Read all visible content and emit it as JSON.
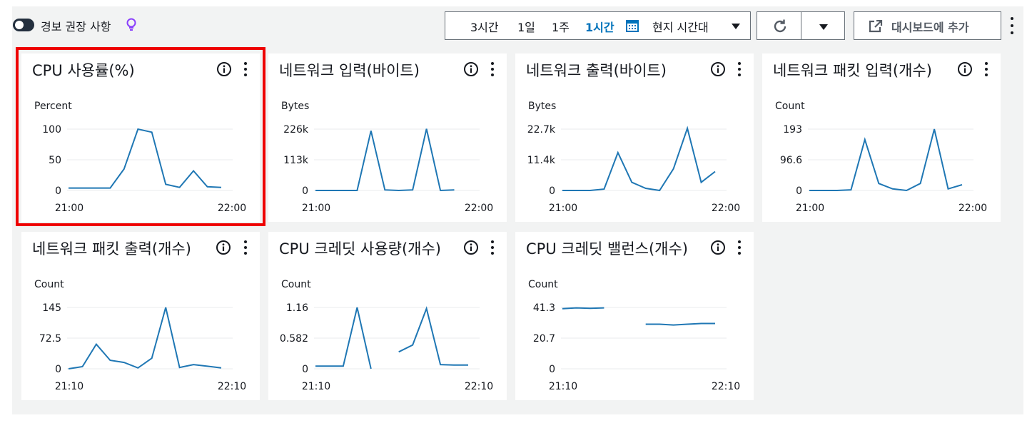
{
  "toolbar": {
    "alarm_label": "경보 권장 사항",
    "alarm_enabled": false,
    "time_options": [
      {
        "label": "3시간",
        "active": false
      },
      {
        "label": "1일",
        "active": false
      },
      {
        "label": "1주",
        "active": false
      },
      {
        "label": "1시간",
        "active": true
      }
    ],
    "timezone": "현지 시간대",
    "add_to_dashboard": "대시보드에 추가",
    "icons": {
      "bulb": "lightbulb-icon",
      "calendar": "calendar-icon",
      "refresh": "refresh-icon",
      "external": "external-link-icon"
    }
  },
  "colors": {
    "line": "#1f77b4",
    "accent": "#0073bb",
    "highlight": "#ee0000",
    "grid": "#e9ebed"
  },
  "widgets": [
    {
      "title": "CPU 사용률(%)",
      "unit": "Percent",
      "yticks": [
        "100",
        "50",
        "0"
      ],
      "ymax": 100,
      "xticks": [
        "21:00",
        "22:00"
      ],
      "selected": true
    },
    {
      "title": "네트워크 입력(바이트)",
      "unit": "Bytes",
      "yticks": [
        "226k",
        "113k",
        "0"
      ],
      "ymax": 226000,
      "xticks": [
        "21:00",
        "22:00"
      ]
    },
    {
      "title": "네트워크 출력(바이트)",
      "unit": "Bytes",
      "yticks": [
        "22.7k",
        "11.4k",
        "0"
      ],
      "ymax": 22700,
      "xticks": [
        "21:00",
        "22:00"
      ]
    },
    {
      "title": "네트워크 패킷 입력(개수)",
      "unit": "Count",
      "yticks": [
        "193",
        "96.6",
        "0"
      ],
      "ymax": 193,
      "xticks": [
        "21:00",
        "22:00"
      ]
    },
    {
      "title": "네트워크 패킷 출력(개수)",
      "unit": "Count",
      "yticks": [
        "145",
        "72.5",
        "0"
      ],
      "ymax": 145,
      "xticks": [
        "21:10",
        "22:10"
      ]
    },
    {
      "title": "CPU 크레딧 사용량(개수)",
      "unit": "Count",
      "yticks": [
        "1.16",
        "0.582",
        "0"
      ],
      "ymax": 1.16,
      "xticks": [
        "21:10",
        "22:10"
      ]
    },
    {
      "title": "CPU 크레딧 밸런스(개수)",
      "unit": "Count",
      "yticks": [
        "41.3",
        "20.7",
        "0"
      ],
      "ymax": 41.3,
      "xticks": [
        "21:10",
        "22:10"
      ]
    }
  ],
  "chart_data": [
    {
      "type": "line",
      "title": "CPU 사용률(%)",
      "ylabel": "Percent",
      "xrange": [
        "21:00",
        "22:00"
      ],
      "ylim": [
        0,
        100
      ],
      "x_minutes": [
        0,
        5,
        10,
        15,
        20,
        25,
        30,
        35,
        40,
        45,
        50,
        55,
        60
      ],
      "series": [
        {
          "values": [
            4,
            4,
            4,
            4,
            35,
            100,
            95,
            10,
            5,
            32,
            6,
            5,
            null
          ]
        }
      ]
    },
    {
      "type": "line",
      "title": "네트워크 입력(바이트)",
      "ylabel": "Bytes",
      "xrange": [
        "21:00",
        "22:00"
      ],
      "ylim": [
        0,
        226000
      ],
      "x_minutes": [
        0,
        5,
        10,
        15,
        20,
        25,
        30,
        35,
        40,
        45,
        50,
        55,
        60
      ],
      "series": [
        {
          "values": [
            0,
            0,
            0,
            0,
            220000,
            2000,
            0,
            2000,
            227000,
            0,
            2000,
            null,
            null
          ]
        }
      ]
    },
    {
      "type": "line",
      "title": "네트워크 출력(바이트)",
      "ylabel": "Bytes",
      "xrange": [
        "21:00",
        "22:00"
      ],
      "ylim": [
        0,
        22700
      ],
      "x_minutes": [
        0,
        5,
        10,
        15,
        20,
        25,
        30,
        35,
        40,
        45,
        50,
        55,
        60
      ],
      "series": [
        {
          "values": [
            0,
            0,
            0,
            500,
            14000,
            3000,
            800,
            0,
            8000,
            23000,
            3000,
            7000,
            null
          ]
        }
      ]
    },
    {
      "type": "line",
      "title": "네트워크 패킷 입력(개수)",
      "ylabel": "Count",
      "xrange": [
        "21:00",
        "22:00"
      ],
      "ylim": [
        0,
        193
      ],
      "x_minutes": [
        0,
        5,
        10,
        15,
        20,
        25,
        30,
        35,
        40,
        45,
        50,
        55,
        60
      ],
      "series": [
        {
          "values": [
            0,
            0,
            0,
            2,
            160,
            22,
            5,
            0,
            22,
            193,
            5,
            18,
            null
          ]
        }
      ]
    },
    {
      "type": "line",
      "title": "네트워크 패킷 출력(개수)",
      "ylabel": "Count",
      "xrange": [
        "21:10",
        "22:10"
      ],
      "ylim": [
        0,
        145
      ],
      "x_minutes": [
        0,
        5,
        10,
        15,
        20,
        25,
        30,
        35,
        40,
        45,
        50,
        55,
        60
      ],
      "series": [
        {
          "values": [
            0,
            5,
            58,
            20,
            15,
            2,
            25,
            145,
            3,
            10,
            6,
            2,
            null
          ]
        }
      ]
    },
    {
      "type": "line",
      "title": "CPU 크레딧 사용량(개수)",
      "ylabel": "Count",
      "xrange": [
        "21:10",
        "22:10"
      ],
      "ylim": [
        0,
        1.16
      ],
      "x_minutes": [
        0,
        5,
        10,
        15,
        20,
        25,
        30,
        35,
        40,
        45,
        50,
        55,
        60
      ],
      "series": [
        {
          "values": [
            0.05,
            0.05,
            0.05,
            1.16,
            0,
            null,
            0.32,
            0.45,
            1.14,
            0.08,
            0.07,
            0.07,
            null
          ]
        }
      ]
    },
    {
      "type": "line",
      "title": "CPU 크레딧 밸런스(개수)",
      "ylabel": "Count",
      "xrange": [
        "21:10",
        "22:10"
      ],
      "ylim": [
        0,
        41.3
      ],
      "x_minutes": [
        0,
        5,
        10,
        15,
        20,
        25,
        30,
        35,
        40,
        45,
        50,
        55,
        60
      ],
      "series": [
        {
          "values": [
            40.5,
            41,
            40.7,
            41,
            null,
            null,
            30,
            30,
            29.5,
            30,
            30.5,
            30.5,
            null
          ]
        }
      ]
    }
  ]
}
